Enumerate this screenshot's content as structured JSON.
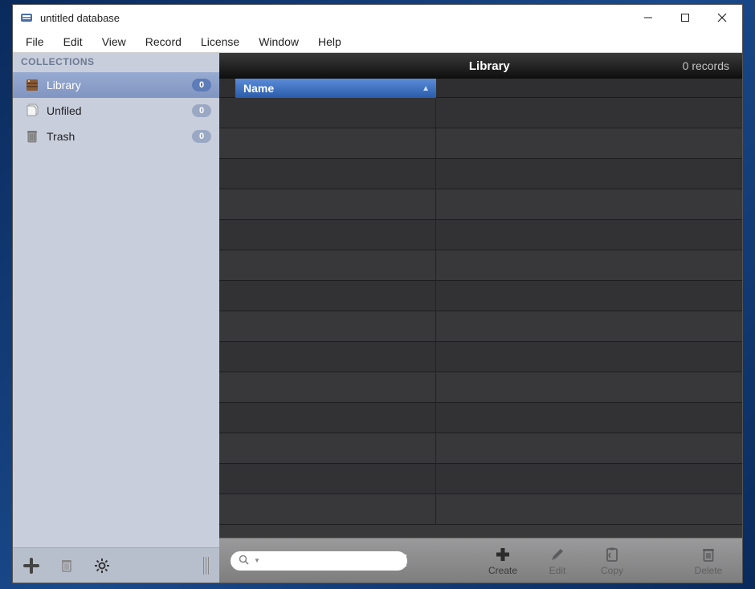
{
  "window": {
    "title": "untitled database"
  },
  "menubar": [
    "File",
    "Edit",
    "View",
    "Record",
    "License",
    "Window",
    "Help"
  ],
  "sidebar": {
    "header": "COLLECTIONS",
    "items": [
      {
        "label": "Library",
        "count": "0",
        "selected": true,
        "icon": "library"
      },
      {
        "label": "Unfiled",
        "count": "0",
        "selected": false,
        "icon": "unfiled"
      },
      {
        "label": "Trash",
        "count": "0",
        "selected": false,
        "icon": "trash"
      }
    ]
  },
  "main": {
    "title": "Library",
    "record_count": "0 records",
    "columns": [
      {
        "label": "Name",
        "sorted": true
      }
    ],
    "row_count": 14
  },
  "toolbar": {
    "search_placeholder": "",
    "buttons": {
      "create": "Create",
      "edit": "Edit",
      "copy": "Copy",
      "delete": "Delete"
    }
  }
}
